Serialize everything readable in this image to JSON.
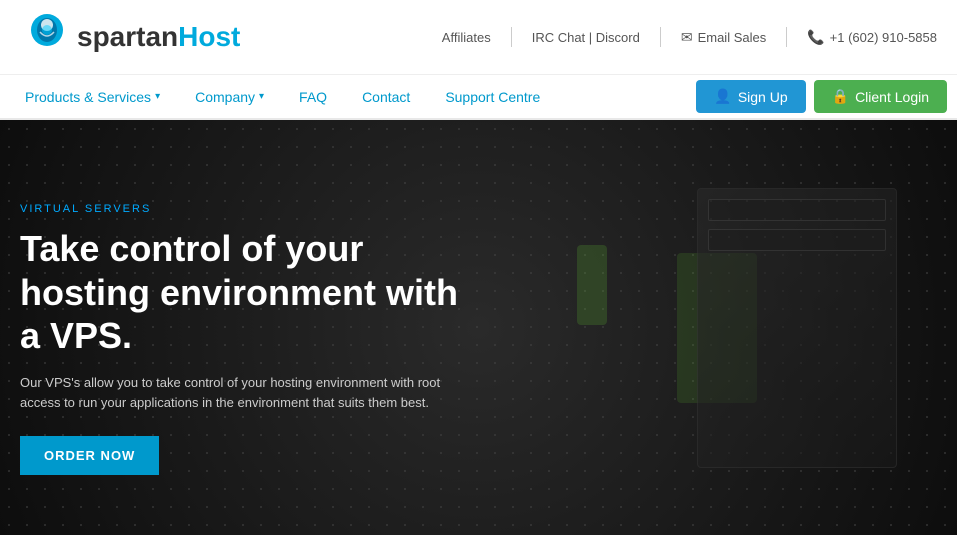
{
  "topbar": {
    "logo": "spartanHost",
    "links": {
      "affiliates": "Affiliates",
      "irc": "IRC Chat | Discord",
      "email_label": "Email Sales",
      "phone": "+1 (602) 910-5858"
    }
  },
  "navbar": {
    "products": "Products & Services",
    "company": "Company",
    "faq": "FAQ",
    "contact": "Contact",
    "support": "Support Centre",
    "signup": "Sign Up",
    "login": "Client Login"
  },
  "hero": {
    "subtitle": "VIRTUAL SERVERS",
    "title": "Take control of your hosting environment with a VPS.",
    "description": "Our VPS's allow you to take control of your hosting environment with root access to run your applications in the environment that suits them best.",
    "cta": "ORDER NOW"
  }
}
